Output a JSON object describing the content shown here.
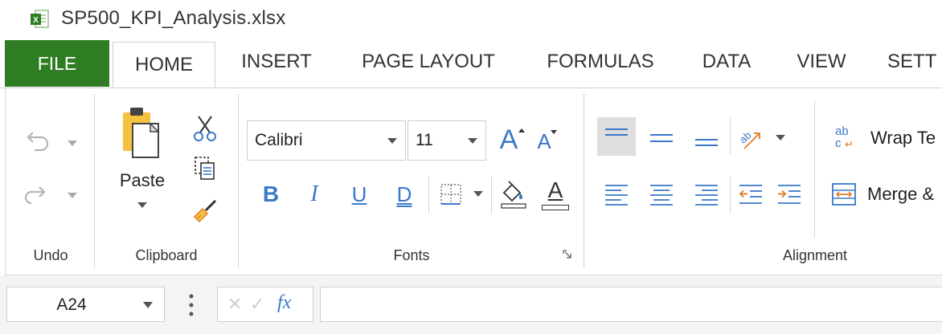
{
  "window": {
    "title": "SP500_KPI_Analysis.xlsx",
    "icon": "excel-file-icon"
  },
  "tabs": [
    {
      "label": "FILE",
      "active": false,
      "color": "#2f7d22"
    },
    {
      "label": "HOME",
      "active": true
    },
    {
      "label": "INSERT",
      "active": false
    },
    {
      "label": "PAGE LAYOUT",
      "active": false
    },
    {
      "label": "FORMULAS",
      "active": false
    },
    {
      "label": "DATA",
      "active": false
    },
    {
      "label": "VIEW",
      "active": false
    },
    {
      "label": "SETT",
      "active": false
    }
  ],
  "ribbon": {
    "undo_group": {
      "label": "Undo",
      "icons": [
        "undo-icon",
        "redo-icon"
      ]
    },
    "clipboard_group": {
      "label": "Clipboard",
      "paste_label": "Paste",
      "icons": [
        "paste-icon",
        "cut-icon",
        "copy-icon",
        "format-painter-icon"
      ]
    },
    "fonts_group": {
      "label": "Fonts",
      "font_name": "Calibri",
      "font_size": "11",
      "grow_glyph": "A",
      "shrink_glyph": "A",
      "bold_glyph": "B",
      "italic_glyph": "I",
      "underline_glyph": "U",
      "double_underline_glyph": "D",
      "font_color_glyph": "A",
      "icons": [
        "borders-icon",
        "fill-color-icon",
        "font-color-icon",
        "dialog-launcher-icon"
      ]
    },
    "alignment_group": {
      "label": "Alignment",
      "wrap_text_label": "Wrap Te",
      "merge_label": "Merge &",
      "wrap_icon_text": "ab",
      "wrap_icon_sub": "c",
      "icons": [
        "align-top-icon",
        "align-middle-icon",
        "align-bottom-icon",
        "orientation-icon",
        "align-left-icon",
        "align-center-icon",
        "align-right-icon",
        "decrease-indent-icon",
        "increase-indent-icon",
        "wrap-text-icon",
        "merge-cells-icon"
      ]
    },
    "accent_color": "#3a78c9"
  },
  "formula_bar": {
    "name_box": "A24",
    "cancel_glyph": "✕",
    "enter_glyph": "✓",
    "fx_label": "fx",
    "formula_value": ""
  }
}
